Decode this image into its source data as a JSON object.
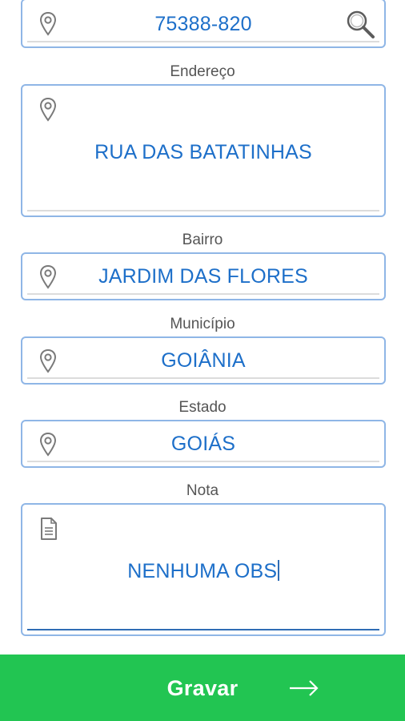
{
  "cep": {
    "value": "75388-820",
    "icon": "location-pin-icon",
    "search_icon": "search-icon"
  },
  "endereco": {
    "label": "Endereço",
    "value": "RUA DAS BATATINHAS",
    "icon": "location-pin-icon"
  },
  "bairro": {
    "label": "Bairro",
    "value": "JARDIM DAS FLORES",
    "icon": "location-pin-icon"
  },
  "municipio": {
    "label": "Município",
    "value": "GOIÂNIA",
    "icon": "location-pin-icon"
  },
  "estado": {
    "label": "Estado",
    "value": "GOIÁS",
    "icon": "location-pin-icon"
  },
  "nota": {
    "label": "Nota",
    "value": "NENHUMA OBS",
    "icon": "document-icon"
  },
  "action": {
    "label": "Gravar",
    "icon": "arrow-right-icon"
  },
  "colors": {
    "accent": "#1d6fc9",
    "border": "#8fb6e6",
    "button": "#22c552",
    "label": "#555555"
  }
}
